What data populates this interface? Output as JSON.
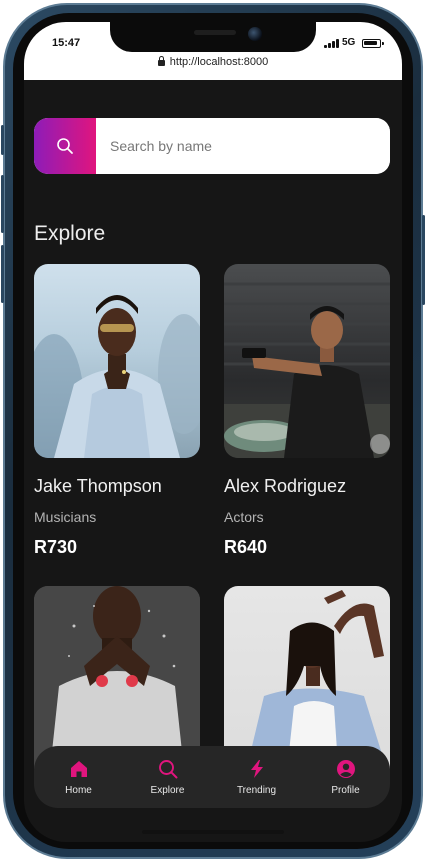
{
  "status_bar": {
    "time": "15:47",
    "network": "5G",
    "url": "http://localhost:8000"
  },
  "search": {
    "placeholder": "Search by name",
    "icon": "search-icon"
  },
  "section_title": "Explore",
  "cards": [
    {
      "name": "Jake Thompson",
      "category": "Musicians",
      "price": "R730"
    },
    {
      "name": "Alex Rodriguez",
      "category": "Actors",
      "price": "R640"
    },
    {
      "name": "",
      "category": "",
      "price": ""
    },
    {
      "name": "",
      "category": "",
      "price": ""
    }
  ],
  "tabbar": {
    "items": [
      {
        "label": "Home",
        "icon": "home-icon"
      },
      {
        "label": "Explore",
        "icon": "search-icon"
      },
      {
        "label": "Trending",
        "icon": "lightning-icon"
      },
      {
        "label": "Profile",
        "icon": "profile-icon"
      }
    ]
  },
  "colors": {
    "accent": "#e0157e",
    "accent_gradient_start": "#8e1cb8",
    "background": "#161616",
    "tabbar_bg": "#262626"
  }
}
